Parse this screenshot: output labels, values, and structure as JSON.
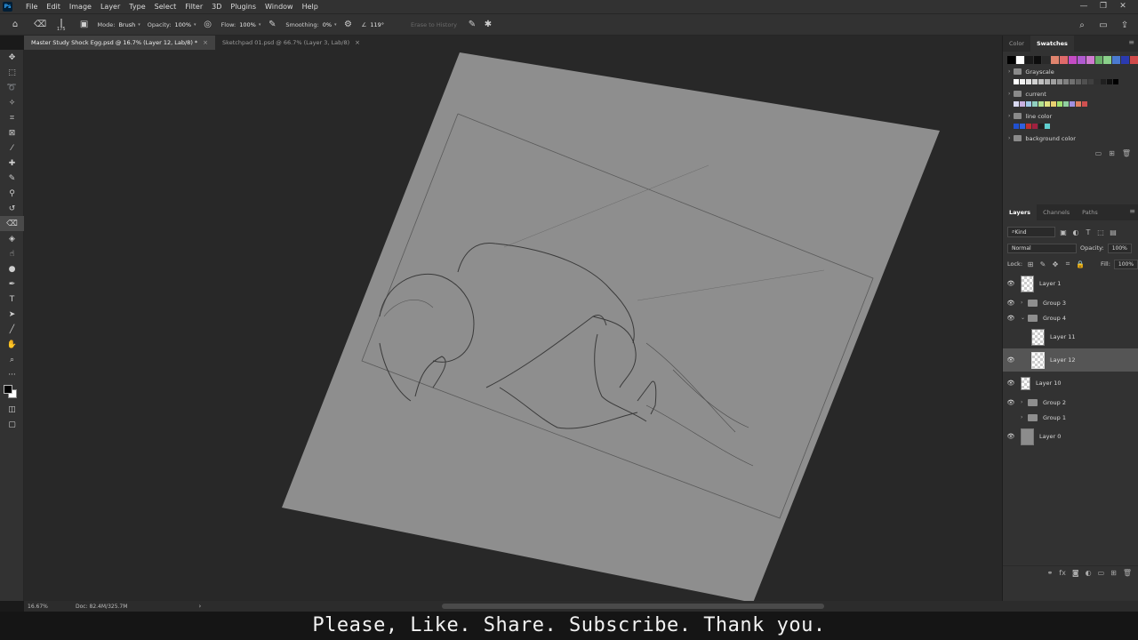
{
  "app": {
    "logo": "Ps"
  },
  "menu": [
    "File",
    "Edit",
    "Image",
    "Layer",
    "Type",
    "Select",
    "Filter",
    "3D",
    "Plugins",
    "Window",
    "Help"
  ],
  "window_controls": [
    "—",
    "❐",
    "✕"
  ],
  "options": {
    "brush_size": "175",
    "mode_label": "Mode:",
    "mode_value": "Brush",
    "opacity_label": "Opacity:",
    "opacity_value": "100%",
    "flow_label": "Flow:",
    "flow_value": "100%",
    "smoothing_label": "Smoothing:",
    "smoothing_value": "0%",
    "angle_value": "119°",
    "erase_history": "Erase to History"
  },
  "tabs": [
    {
      "label": "Master Study Shock Egg.psd @ 16.7% (Layer 12, Lab/8) *"
    },
    {
      "label": "Sketchpad 01.psd @ 66.7% (Layer 3, Lab/8)"
    }
  ],
  "status": {
    "zoom": "16.67%",
    "doc": "Doc: 82.4M/325.7M"
  },
  "caption": "Please, Like. Share. Subscribe. Thank you.",
  "swatches_panel": {
    "tabs": [
      "Color",
      "Swatches"
    ],
    "recent": [
      "#000000",
      "#ffffff",
      "#1a1a1a",
      "#0d0d0d",
      "#2a2a2a",
      "#e0846e",
      "#e06a6a",
      "#c44bc4",
      "#b05ad0",
      "#d07ad0",
      "#6ab06a",
      "#8ad08a",
      "#4a7ad0",
      "#2a3ab0",
      "#d04a4a"
    ],
    "groups": [
      {
        "name": "Grayscale",
        "colors": [
          "#ffffff",
          "#f0f0f0",
          "#e0e0e0",
          "#d0d0d0",
          "#c0c0c0",
          "#b0b0b0",
          "#a0a0a0",
          "#909090",
          "#808080",
          "#707070",
          "#606060",
          "#505050",
          "#404040",
          "#303030",
          "#202020",
          "#101010",
          "#000000"
        ]
      },
      {
        "name": "current",
        "colors": [
          "#d8d8f0",
          "#c8b0e0",
          "#a0c8e8",
          "#90d0c0",
          "#b0e090",
          "#e0e080",
          "#e8d070",
          "#a0e070",
          "#90d0a0",
          "#a090e0",
          "#e08060",
          "#d05050"
        ]
      },
      {
        "name": "line color",
        "colors": [
          "#2050d0",
          "#3060e0",
          "#c03030",
          "#a02040",
          "#202020",
          "#60d0d0"
        ]
      },
      {
        "name": "background color",
        "colors": []
      }
    ]
  },
  "layers_panel": {
    "tabs": [
      "Layers",
      "Channels",
      "Paths"
    ],
    "filter_kind": "Kind",
    "blend_mode": "Normal",
    "opacity_label": "Opacity:",
    "opacity_value": "100%",
    "lock_label": "Lock:",
    "fill_label": "Fill:",
    "fill_value": "100%",
    "layers": [
      {
        "name": "Layer 1",
        "type": "layer",
        "visible": true
      },
      {
        "name": "Group 3",
        "type": "group",
        "visible": true
      },
      {
        "name": "Group 4",
        "type": "group-open",
        "visible": true
      },
      {
        "name": "Layer 11",
        "type": "layer",
        "visible": false,
        "indent": true
      },
      {
        "name": "Layer 12",
        "type": "layer",
        "visible": true,
        "indent": true,
        "selected": true
      },
      {
        "name": "Layer 10",
        "type": "layer-small",
        "visible": true
      },
      {
        "name": "Group 2",
        "type": "group",
        "visible": true
      },
      {
        "name": "Group 1",
        "type": "group",
        "visible": false
      },
      {
        "name": "Layer 0",
        "type": "layer-gray",
        "visible": true
      }
    ]
  }
}
